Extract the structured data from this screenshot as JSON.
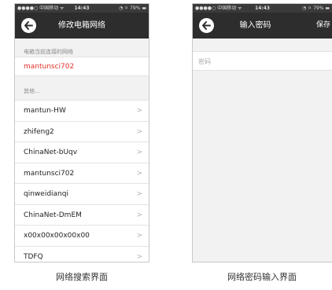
{
  "left_screen": {
    "status": {
      "carrier": "●●●●○ 中国移动 ᯤ",
      "time": "14:43",
      "battery": "◔ ⚪ 79% ▬"
    },
    "title": "修改电箱网络",
    "current_section_label": "电箱当前连接的网络",
    "current_network": "mantunsci702",
    "others_section_label": "其他...",
    "networks": [
      {
        "name": "mantun-HW"
      },
      {
        "name": "zhifeng2"
      },
      {
        "name": "ChinaNet-bUqv"
      },
      {
        "name": "mantunsci702"
      },
      {
        "name": "qinweidianqi"
      },
      {
        "name": "ChinaNet-DmEM"
      },
      {
        "name": "x00x00x00x00x00"
      },
      {
        "name": "TDFQ"
      }
    ],
    "chevron": ">"
  },
  "right_screen": {
    "status": {
      "carrier": "●●●●○ 中国移动 ᯤ",
      "time": "14:43",
      "battery": "◔ ⚪ 79% ▬"
    },
    "title": "输入密码",
    "save_label": "保存",
    "password_placeholder": "密码"
  },
  "captions": {
    "left": "网络搜索界面",
    "right": "网络密码输入界面"
  }
}
